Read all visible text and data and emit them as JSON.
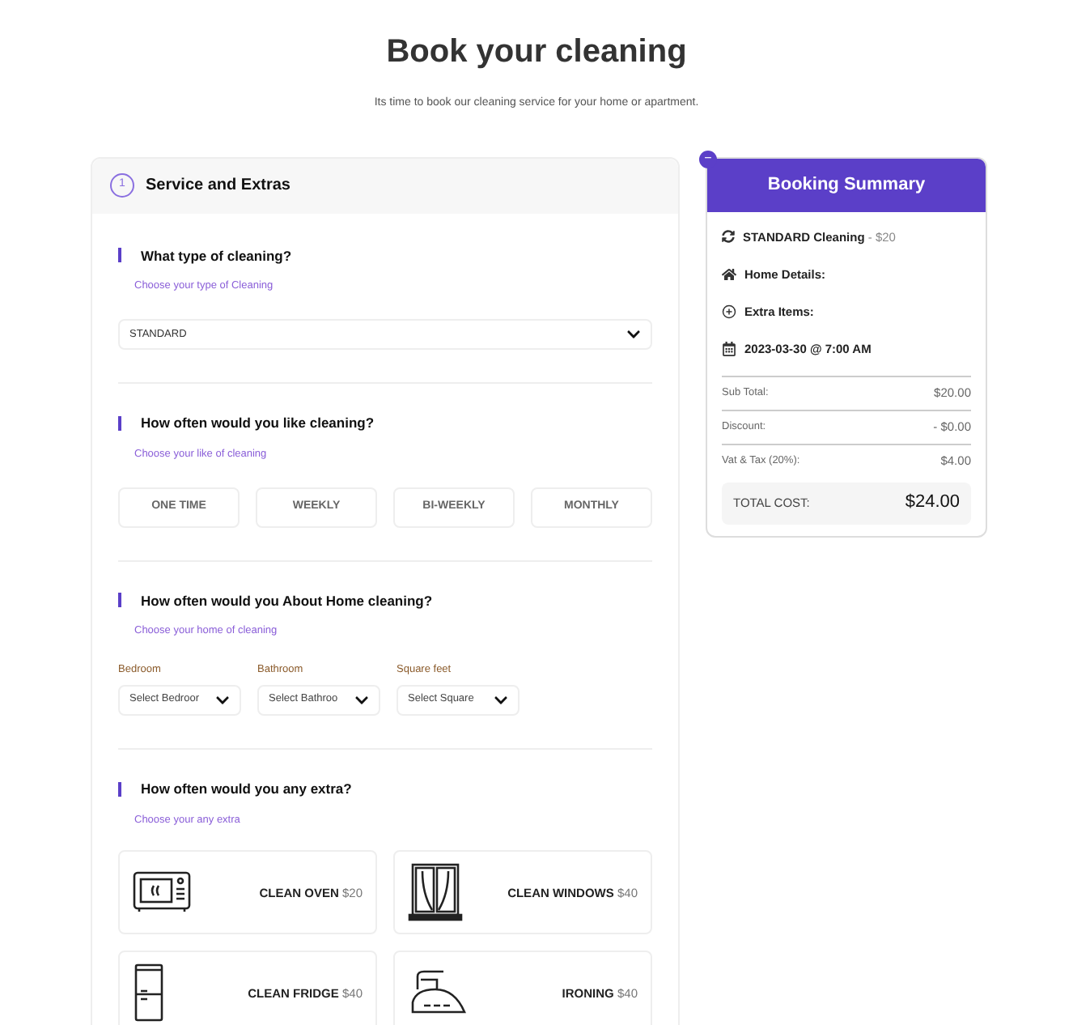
{
  "title": "Book your cleaning",
  "subtitle": "Its time to book our cleaning service for your home or apartment.",
  "step": {
    "number": "1",
    "title": "Service and Extras"
  },
  "type_section": {
    "question": "What type of cleaning?",
    "hint": "Choose your type of Cleaning",
    "value": "STANDARD"
  },
  "frequency_section": {
    "question": "How often would you like cleaning?",
    "hint": "Choose your like of cleaning",
    "options": [
      {
        "label": "ONE TIME",
        "selected": false
      },
      {
        "label": "WEEKLY",
        "selected": false
      },
      {
        "label": "BI-WEEKLY",
        "selected": false
      },
      {
        "label": "MONTHLY",
        "selected": false
      }
    ]
  },
  "home_section": {
    "question": "How often would you About Home cleaning?",
    "hint": "Choose your home of cleaning",
    "fields": [
      {
        "label": "Bedroom",
        "value": "Select Bedroor"
      },
      {
        "label": "Bathroom",
        "value": "Select Bathroo"
      },
      {
        "label": "Square feet",
        "value": "Select Square"
      }
    ]
  },
  "extras_section": {
    "question": "How often would you any extra?",
    "hint": "Choose your any extra",
    "items": [
      {
        "kind": "oven",
        "name": "CLEAN OVEN",
        "price": "$20"
      },
      {
        "kind": "windows",
        "name": "CLEAN WINDOWS",
        "price": "$40"
      },
      {
        "kind": "fridge",
        "name": "CLEAN FRIDGE",
        "price": "$40"
      },
      {
        "kind": "iron",
        "name": "IRONING",
        "price": "$40"
      }
    ]
  },
  "summary": {
    "title": "Booking Summary",
    "collapse": "−",
    "items": [
      {
        "kind": "service",
        "label": "STANDARD Cleaning",
        "note": "- $20"
      },
      {
        "kind": "home",
        "label": "Home Details:"
      },
      {
        "kind": "extra",
        "label": "Extra Items:"
      },
      {
        "kind": "date",
        "label": "2023-03-30 @ 7:00 AM"
      }
    ],
    "lines": [
      {
        "label": "Sub Total:",
        "value": "$20.00"
      },
      {
        "label": "Discount:",
        "value": "- $0.00"
      },
      {
        "label": "Vat & Tax (20%):",
        "value": "$4.00"
      }
    ],
    "total": {
      "label": "TOTAL COST:",
      "value": "$24.00"
    }
  }
}
